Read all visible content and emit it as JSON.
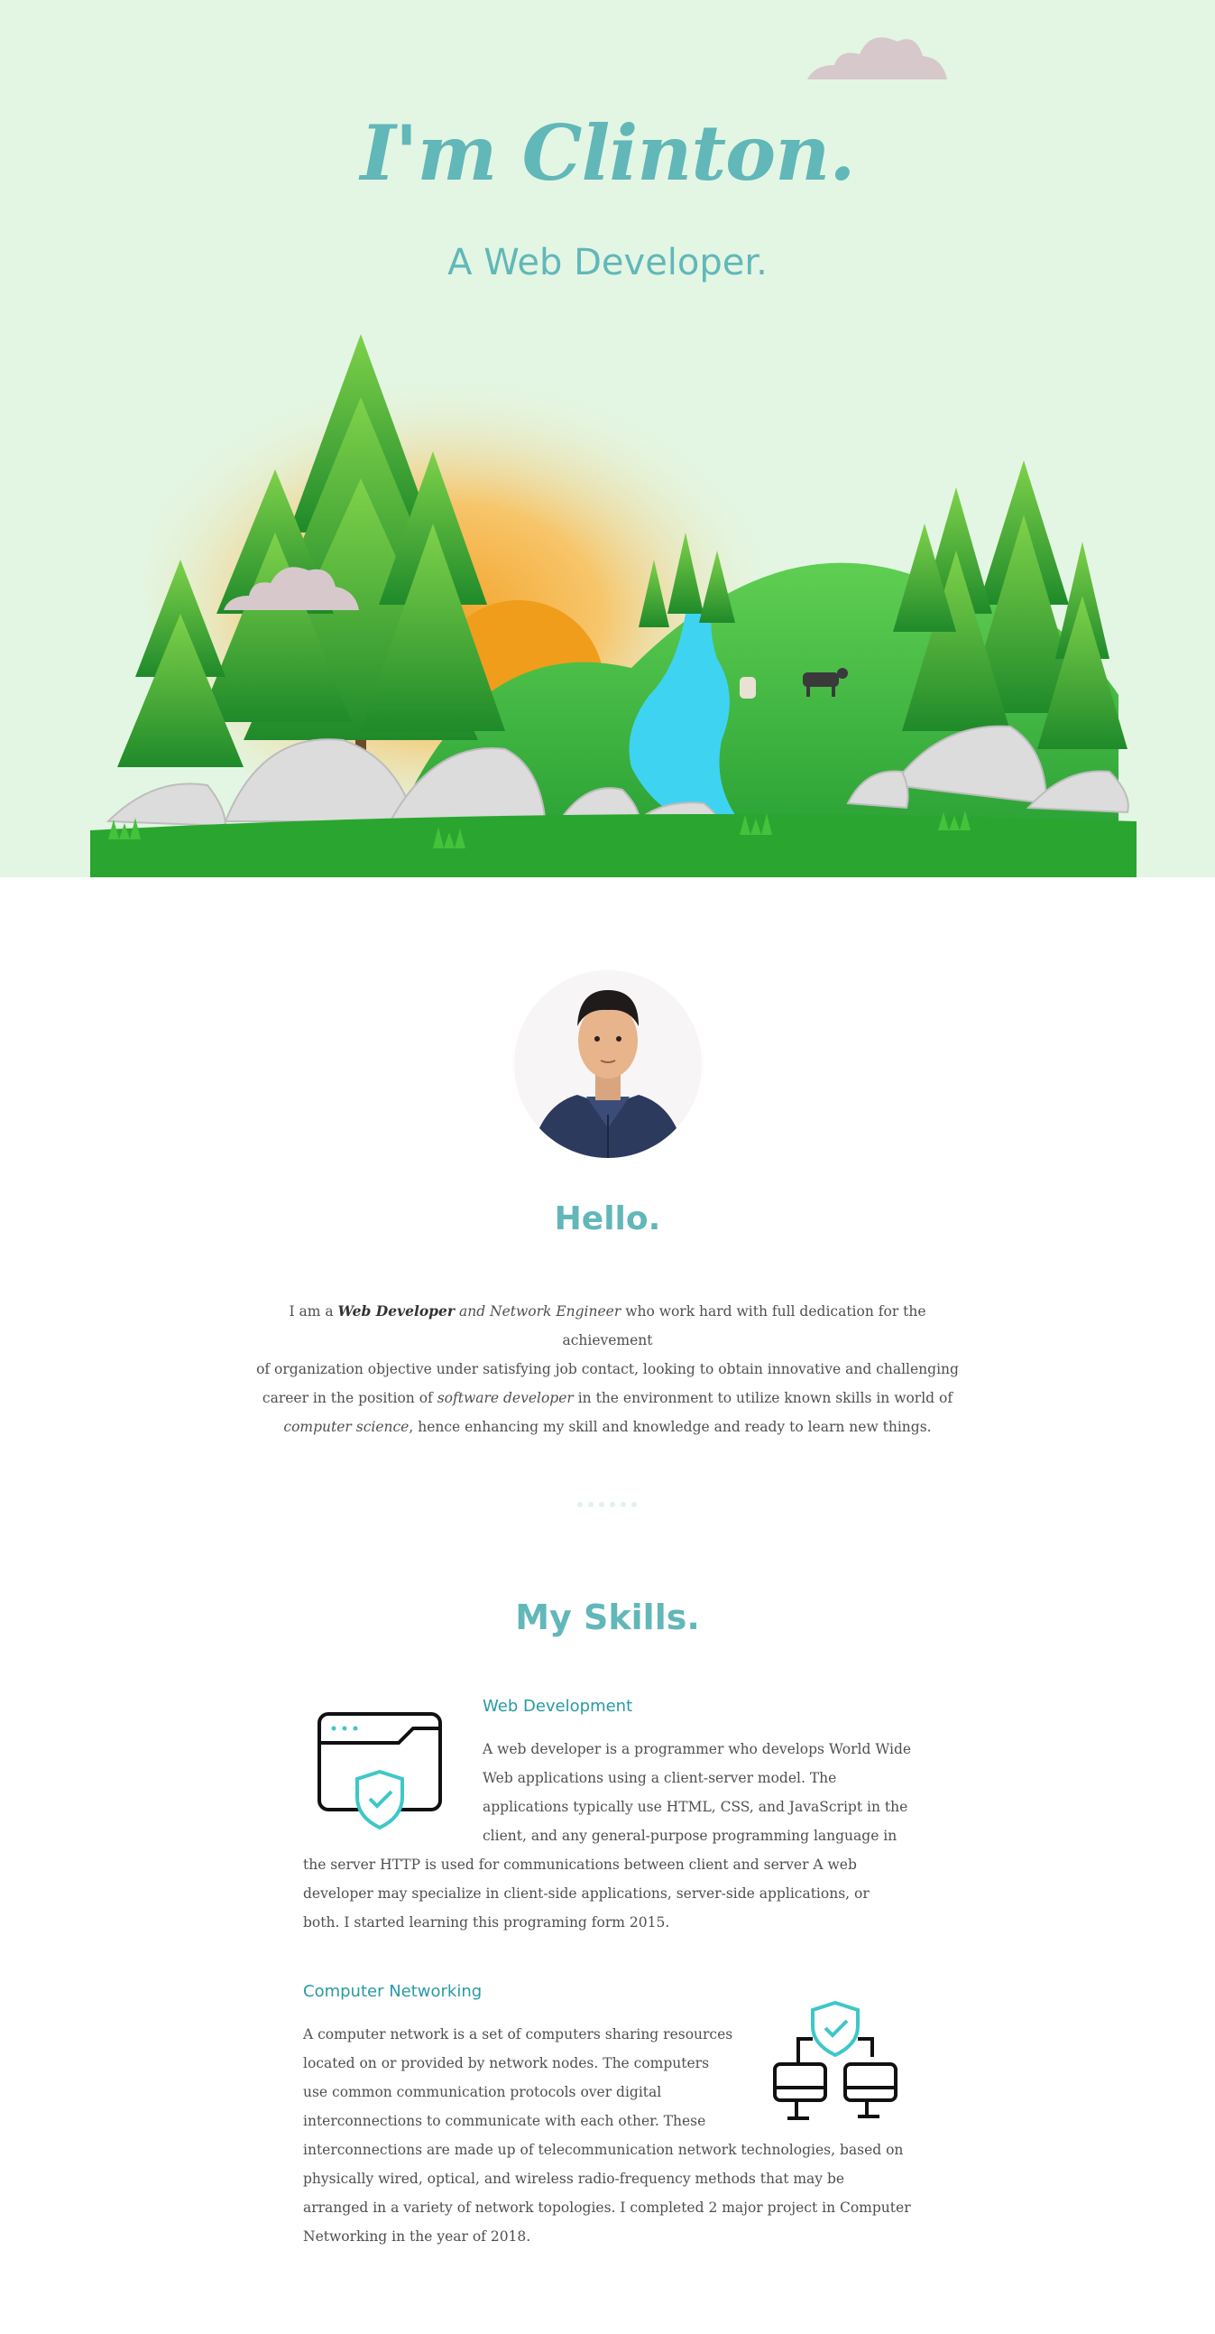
{
  "hero": {
    "title": "I'm Clinton.",
    "subtitle": "A Web Developer."
  },
  "about": {
    "avatar_alt": "profile-photo",
    "greeting": "Hello.",
    "bio": {
      "p1": "I am a ",
      "role1": "Web Developer",
      "p2": " and Network Engineer",
      "p3": " who work hard with full dedication for the achievement",
      "line2": "of organization objective under satisfying job contact, looking to obtain innovative and challenging",
      "line3a": "career in the position of ",
      "line3b": "software developer",
      "line3c": " in the environment to utilize known skills in world of",
      "line4a": "computer science",
      "line4b": ", hence enhancing my skill and knowledge and ready to learn new things."
    }
  },
  "skills": {
    "title": "My Skills.",
    "items": [
      {
        "heading": "Web Development",
        "icon": "browser-shield-icon",
        "lines": [
          "A web developer is a programmer who develops World Wide",
          "Web applications using a client-server model. The",
          "applications typically use HTML, CSS, and JavaScript in the",
          "client, and any general-purpose programming language in",
          "the server HTTP is used for communications between client and server A web",
          "developer may specialize in client-side applications, server-side applications, or",
          "both. I started learning this programing form 2015."
        ]
      },
      {
        "heading": "Computer Networking",
        "icon": "network-shield-icon",
        "lines": [
          "A computer network is a set of computers sharing resources",
          "located on or provided by network nodes. The computers",
          "use common communication protocols over digital",
          "interconnections to communicate with each other. These",
          "interconnections are made up of telecommunication network technologies, based on",
          "physically wired, optical, and wireless radio-frequency methods that may be",
          "arranged in a variety of network topologies. I completed 2 major project in Computer",
          "Networking in the year of 2018."
        ]
      }
    ]
  },
  "colors": {
    "hero_bg": "#e3f6e3",
    "accent": "#62b7b9",
    "heading_teal": "#2a9aa3",
    "cloud": "#d7c8cc",
    "tree_green": "#3aa83a",
    "sun": "#f2a630",
    "river": "#3fd3f2"
  }
}
